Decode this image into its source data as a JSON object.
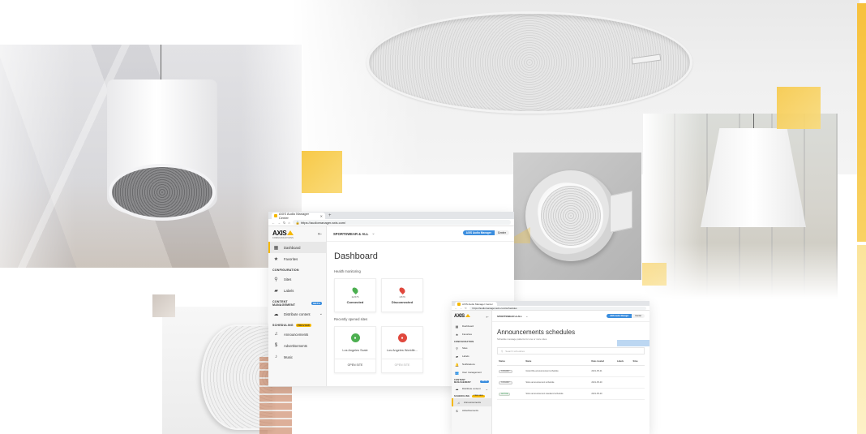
{
  "colors": {
    "accent_yellow": "#f5b800",
    "blue_badge": "#3a8dde",
    "connected_green": "#4caf50",
    "disconnected_red": "#e0483d"
  },
  "dashboard_window": {
    "tab_title": "AXIS Audio Manager Center",
    "new_tab": "+",
    "url": "https://audiomanager.axis.com/",
    "logo_text": "AXIS",
    "logo_sub": "COMMUNICATIONS",
    "site_selector": "SPORTSWEAR & ALL",
    "badge_primary": "AXIS Audio Manager",
    "badge_secondary": "Center",
    "sidebar": {
      "top_items": [
        {
          "label": "Dashboard",
          "icon": "dashboard-icon",
          "active": true
        },
        {
          "label": "Favorites",
          "icon": "star-icon",
          "active": false
        }
      ],
      "configuration_label": "CONFIGURATION",
      "configuration_items": [
        {
          "label": "Sites",
          "icon": "location-pin-icon"
        },
        {
          "label": "Labels",
          "icon": "label-icon"
        }
      ],
      "content_label": "CONTENT MANAGEMENT",
      "content_pill": "BETA",
      "content_items": [
        {
          "label": "Distribute content",
          "icon": "cloud-icon"
        }
      ],
      "scheduling_label": "SCHEDULING",
      "scheduling_pill": "PREVIEW",
      "scheduling_items": [
        {
          "label": "Announcements",
          "icon": "announcement-icon"
        },
        {
          "label": "Advertisements",
          "icon": "dollar-icon"
        },
        {
          "label": "Music",
          "icon": "music-note-icon"
        }
      ]
    },
    "main": {
      "title": "Dashboard",
      "health_label": "Health monitoring",
      "health_cards": [
        {
          "num": "11/676",
          "label": "Connected"
        },
        {
          "num": "1/676",
          "label": "Disconnected"
        }
      ],
      "recent_label": "Recently opened sites",
      "site_cards": [
        {
          "name": "Los Angeles Scale",
          "action": "OPEN SITE"
        },
        {
          "name": "Los Angeles Worldfe...",
          "action": "OPEN SITE"
        }
      ]
    }
  },
  "schedule_window": {
    "tab_title": "AXIS Audio Manager Center",
    "url": "https://audiomanager.axis.com/schedules",
    "logo_text": "AXIS",
    "site_selector": "SPORTSWEAR & ALL",
    "badge_primary": "AXIS Audio Manager",
    "badge_secondary": "Center",
    "sidebar_items": [
      {
        "label": "Dashboard",
        "icon": "dashboard-icon"
      },
      {
        "label": "Favorites",
        "icon": "star-icon"
      }
    ],
    "configuration_label": "CONFIGURATION",
    "configuration_items": [
      {
        "label": "Sites",
        "icon": "location-pin-icon"
      },
      {
        "label": "Labels",
        "icon": "label-icon"
      },
      {
        "label": "Notifications",
        "icon": "bell-icon"
      },
      {
        "label": "User management",
        "icon": "users-icon"
      }
    ],
    "content_label": "CONTENT MANAGEMENT",
    "content_pill": "BETA",
    "content_items": [
      {
        "label": "Distribute content",
        "icon": "cloud-icon"
      }
    ],
    "scheduling_label": "SCHEDULING",
    "scheduling_pill": "PREVIEW",
    "scheduling_items": [
      {
        "label": "Announcements",
        "icon": "announcement-icon",
        "active": true
      },
      {
        "label": "Advertisements",
        "icon": "dollar-icon"
      }
    ],
    "main": {
      "title": "Announcements schedules",
      "subtitle": "Schedule message patterns for one or more sites.",
      "search_placeholder": "Search schedules",
      "columns": [
        "Status",
        "Name",
        "Date created",
        "Labels",
        "Sites"
      ],
      "rows": [
        {
          "status": "STANDBY",
          "name": "Grand Re-announcement schedule",
          "date": "2021-05-21"
        },
        {
          "status": "STANDBY",
          "name": "Store announcement schedule",
          "date": "2021-05-20"
        },
        {
          "status": "ACTIVE",
          "name": "Store announcement weekend schedule",
          "date": "2021-05-20"
        }
      ]
    }
  }
}
